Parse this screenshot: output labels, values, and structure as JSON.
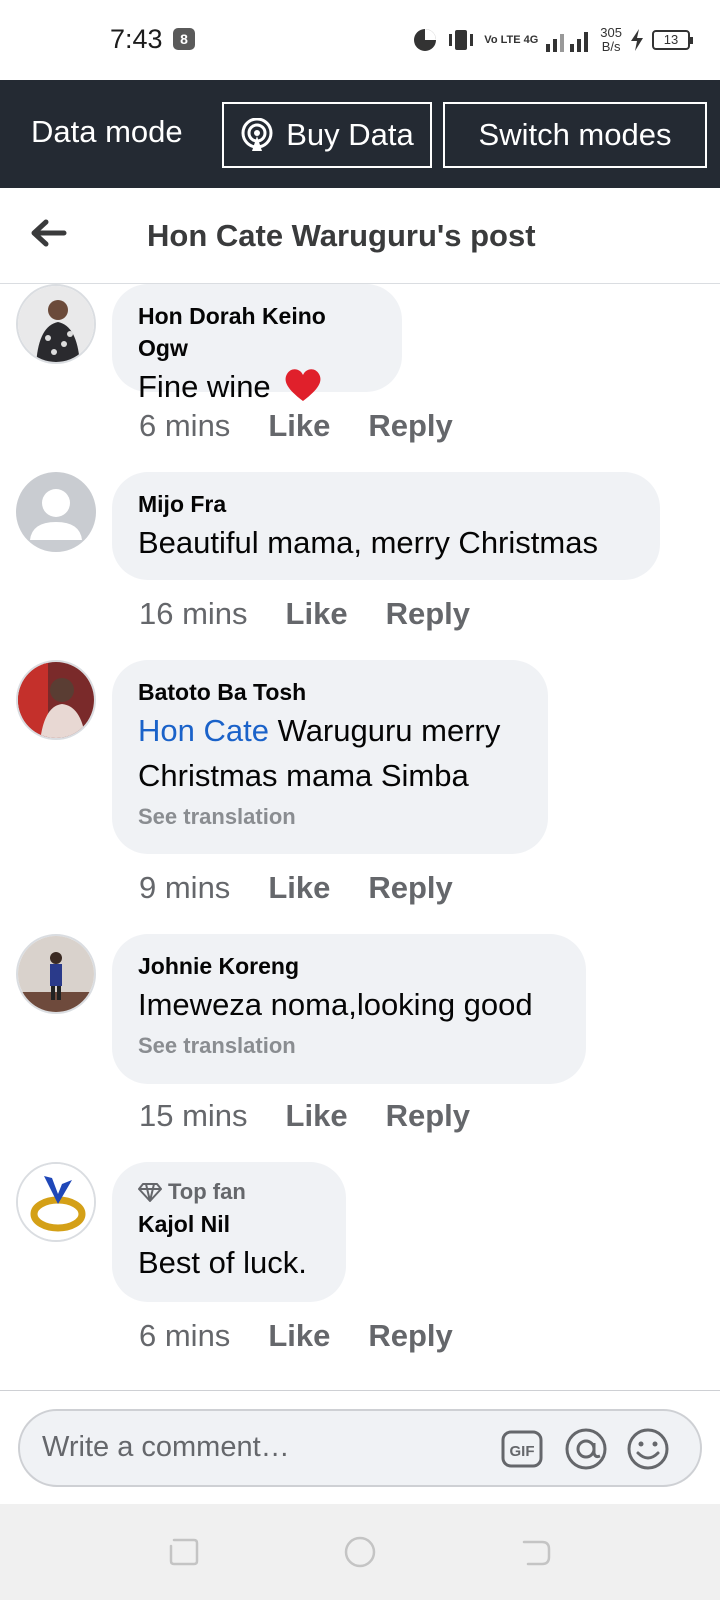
{
  "status_bar": {
    "time": "7:43",
    "app_icon_glyph": "8",
    "network": "Vo LTE 4G",
    "speed_value": "305",
    "speed_unit": "B/s",
    "battery": "13"
  },
  "data_bar": {
    "label": "Data mode",
    "buy_label": "Buy Data",
    "switch_label": "Switch modes"
  },
  "header": {
    "title": "Hon Cate Waruguru's post"
  },
  "comments": [
    {
      "author": "Hon Dorah Keino Ogw",
      "text": "Fine wine",
      "emoji": "heart",
      "time": "6 mins",
      "like": "Like",
      "reply": "Reply"
    },
    {
      "author": "Mijo Fra",
      "text": "Beautiful mama, merry Christmas",
      "time": "16 mins",
      "like": "Like",
      "reply": "Reply"
    },
    {
      "author": "Batoto Ba Tosh",
      "mention": "Hon Cate",
      "text_line1": " Waruguru merry",
      "text_line2": "Christmas mama Simba",
      "see_translation": "See translation",
      "time": "9 mins",
      "like": "Like",
      "reply": "Reply"
    },
    {
      "author": "Johnie Koreng",
      "text": "Imeweza noma,looking good",
      "see_translation": "See translation",
      "time": "15 mins",
      "like": "Like",
      "reply": "Reply"
    },
    {
      "badge": "Top fan",
      "author": "Kajol Nil",
      "text": "Best of luck.",
      "time": "6 mins",
      "like": "Like",
      "reply": "Reply"
    }
  ],
  "composer": {
    "placeholder": "Write a comment…",
    "gif_label": "GIF"
  },
  "colors": {
    "data_bar_bg": "#242a33",
    "bubble_bg": "#f0f2f5",
    "mention_link": "#1a62c9",
    "meta_text": "#65676b",
    "heart": "#e0202b"
  }
}
